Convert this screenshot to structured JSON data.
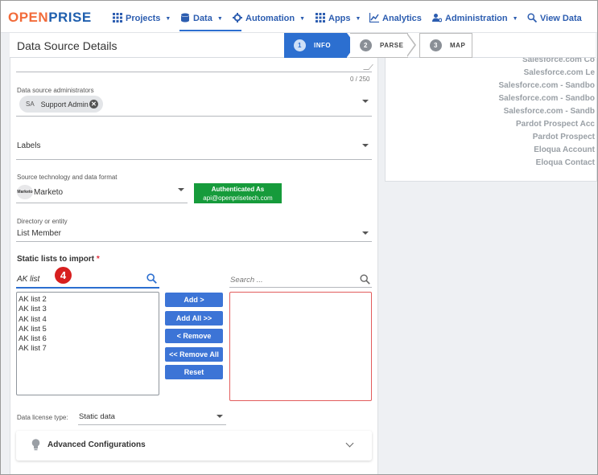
{
  "nav": {
    "logo_open": "OPEN",
    "logo_prise": "PRISE",
    "items": [
      {
        "label": "Projects",
        "icon": "grid-icon"
      },
      {
        "label": "Data",
        "icon": "database-icon"
      },
      {
        "label": "Automation",
        "icon": "gear-icon"
      },
      {
        "label": "Apps",
        "icon": "grid-icon"
      },
      {
        "label": "Analytics",
        "icon": "chart-icon"
      },
      {
        "label": "Administration",
        "icon": "users-gear-icon"
      },
      {
        "label": "View Data",
        "icon": "search-icon"
      }
    ],
    "active": "Data",
    "accent": "#2c6fd0"
  },
  "header": {
    "title": "Data Source Details",
    "steps": [
      {
        "num": "1",
        "label": "INFO",
        "state": "active"
      },
      {
        "num": "2",
        "label": "PARSE",
        "state": "inactive"
      },
      {
        "num": "3",
        "label": "MAP",
        "state": "inactive"
      }
    ]
  },
  "form": {
    "char_count": "0 / 250",
    "admins": {
      "label": "Data source administrators",
      "chip_initials": "SA",
      "chip_name": "Support Admin"
    },
    "labels_field": {
      "label": "Labels"
    },
    "source_tech": {
      "label": "Source technology and data format",
      "icon_text": "Marketo",
      "value": "Marketo"
    },
    "auth": {
      "title": "Authenticated As",
      "email": "api@openprisetech.com"
    },
    "directory": {
      "label": "Directory or entity",
      "value": "List Member"
    },
    "static_lists": {
      "title": "Static lists to import",
      "required_mark": "*",
      "search_value": "AK list",
      "target_placeholder": "Search ...",
      "available": [
        "AK list 2",
        "AK list 3",
        "AK list 4",
        "AK list 5",
        "AK list 6",
        "AK list 7"
      ],
      "callout_number": "4"
    },
    "buttons": {
      "add": "Add >",
      "add_all": "Add All >>",
      "remove": "< Remove",
      "remove_all": "<< Remove All",
      "reset": "Reset"
    },
    "license": {
      "label": "Data license type:",
      "value": "Static data"
    },
    "advanced": {
      "title": "Advanced Configurations"
    }
  },
  "right_panel": {
    "items": [
      "Salesforce.com Co",
      "Salesforce.com Le",
      "Salesforce.com - Sandbo",
      "Salesforce.com - Sandbo",
      "Salesforce.com - Sandb",
      "Pardot Prospect Acc",
      "Pardot Prospect",
      "Eloqua Account",
      "Eloqua Contact"
    ]
  }
}
